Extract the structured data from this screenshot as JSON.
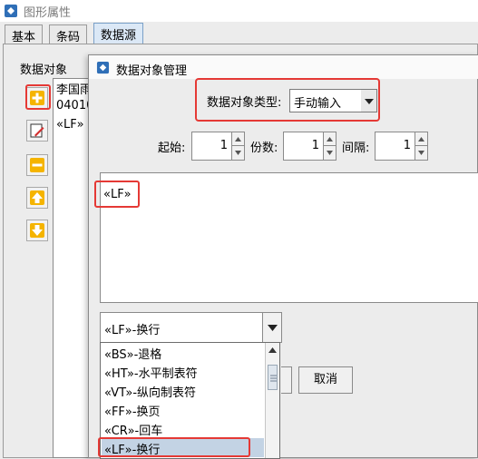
{
  "window": {
    "title": "图形属性",
    "tabs": [
      "基本",
      "条码",
      "数据源"
    ]
  },
  "data_objects": {
    "label": "数据对象",
    "items": [
      "李国雨",
      "04010",
      "«LF»"
    ]
  },
  "side_buttons": [
    "add-icon",
    "edit-icon",
    "remove-icon",
    "move-up-icon",
    "move-down-icon"
  ],
  "dialog": {
    "title": "数据对象管理",
    "type_label": "数据对象类型:",
    "type_value": "手动输入",
    "start_label": "起始:",
    "start_value": "1",
    "copies_label": "份数:",
    "copies_value": "1",
    "interval_label": "间隔:",
    "interval_value": "1",
    "text_value": "«LF»",
    "control_select_value": "«LF»-换行",
    "ok_label": "",
    "cancel_label": "取消"
  },
  "popup_options": [
    "«BS»-退格",
    "«HT»-水平制表符",
    "«VT»-纵向制表符",
    "«FF»-换页",
    "«CR»-回车",
    "«LF»-换行"
  ],
  "colors": {
    "highlight": "#e53935",
    "selected_bg": "#c3d3e4",
    "accent": "#2f6fb7"
  }
}
